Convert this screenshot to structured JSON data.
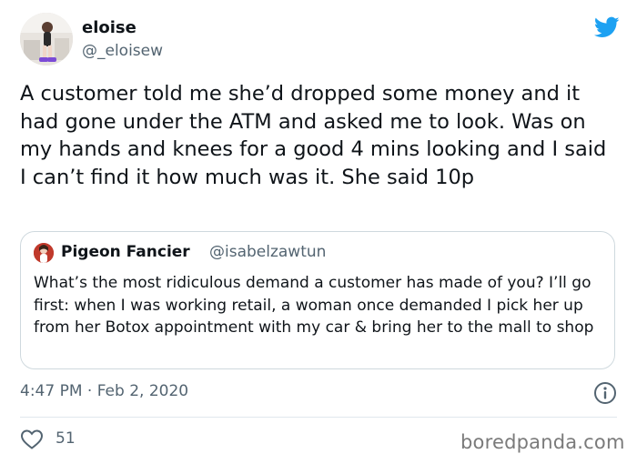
{
  "tweet": {
    "author": {
      "display_name": "eloise",
      "handle": "@_eloisew",
      "avatar_icon": "profile-photo"
    },
    "text": "A customer told me she’d dropped some money and it had gone under the ATM and asked me to look. Was on my hands and knees for a good 4 mins looking and I said I can’t find it how much was it. She said 10p",
    "quoted": {
      "display_name": "Pigeon Fancier",
      "handle": "@isabelzawtun",
      "text": "What’s the most ridiculous demand a customer has made of you? I’ll go first: when I was working retail, a woman once demanded I pick her up from her Botox appointment with my car & bring her to the mall to shop"
    },
    "timestamp": "4:47 PM · Feb 2, 2020",
    "likes": "51"
  },
  "brand": {
    "logo_icon": "twitter-bird-icon",
    "accent_color": "#1da1f2"
  },
  "watermark": "boredpanda.com"
}
